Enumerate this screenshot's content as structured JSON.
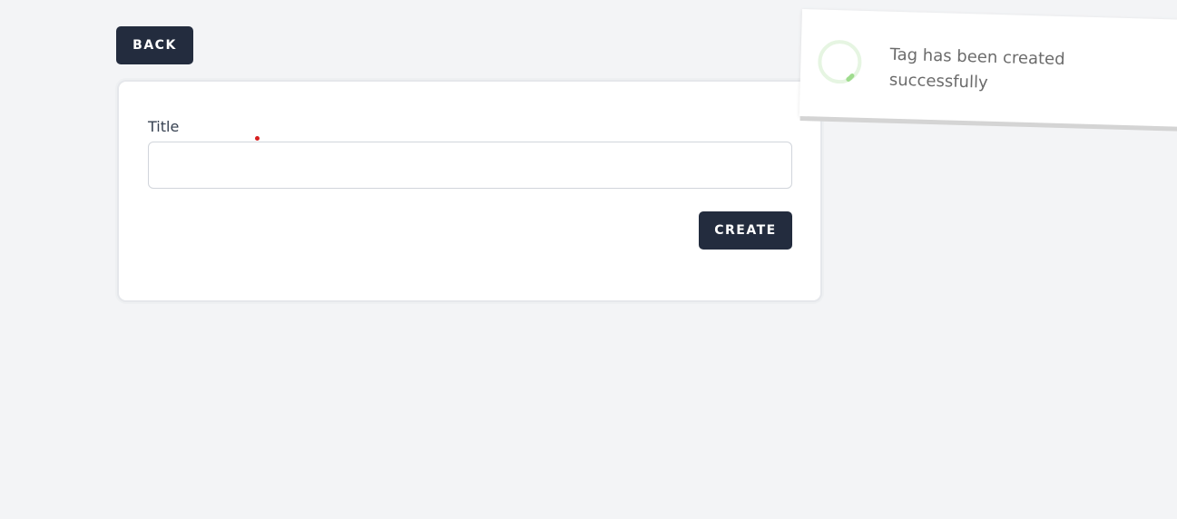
{
  "header": {
    "back_label": "BACK"
  },
  "form": {
    "title_label": "Title",
    "title_value": "",
    "title_placeholder": "",
    "create_label": "CREATE"
  },
  "toast": {
    "message": "Tag has been created successfully",
    "status": "success",
    "icon": "loading-spinner-icon",
    "accent_color": "#a8e29a"
  },
  "colors": {
    "primary_button": "#232c3e",
    "background": "#f3f4f6",
    "required_marker": "#d61f1f"
  }
}
